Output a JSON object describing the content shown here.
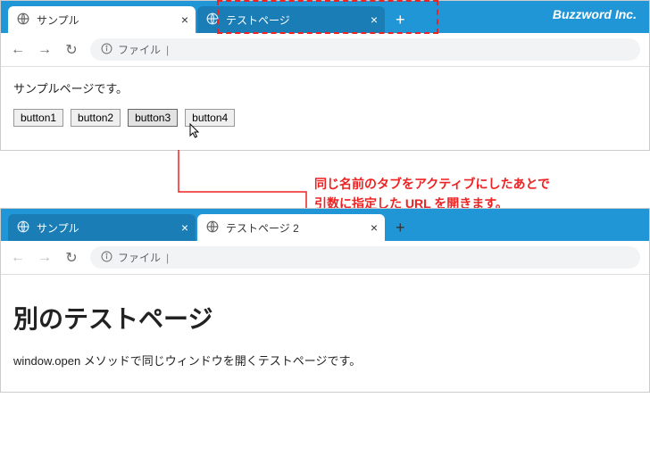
{
  "brand": "Buzzword Inc.",
  "browser1": {
    "tabs": [
      {
        "label": "サンプル",
        "active": true
      },
      {
        "label": "テストページ",
        "active": false
      }
    ],
    "newtab": "+",
    "nav": {
      "back": "←",
      "forward": "→",
      "reload": "↻"
    },
    "address_label": "ファイル",
    "page_text": "サンプルページです。",
    "buttons": [
      "button1",
      "button2",
      "button3",
      "button4"
    ]
  },
  "annotation": {
    "line1": "同じ名前のタブをアクティブにしたあとで",
    "line2": "引数に指定した URL を開きます。"
  },
  "browser2": {
    "tabs": [
      {
        "label": "サンプル",
        "active": false
      },
      {
        "label": "テストページ 2",
        "active": true
      }
    ],
    "newtab": "+",
    "nav": {
      "back": "←",
      "forward": "→",
      "reload": "↻"
    },
    "address_label": "ファイル",
    "heading": "別のテストページ",
    "body": "window.open メソッドで同じウィンドウを開くテストページです。"
  },
  "close_glyph": "×"
}
